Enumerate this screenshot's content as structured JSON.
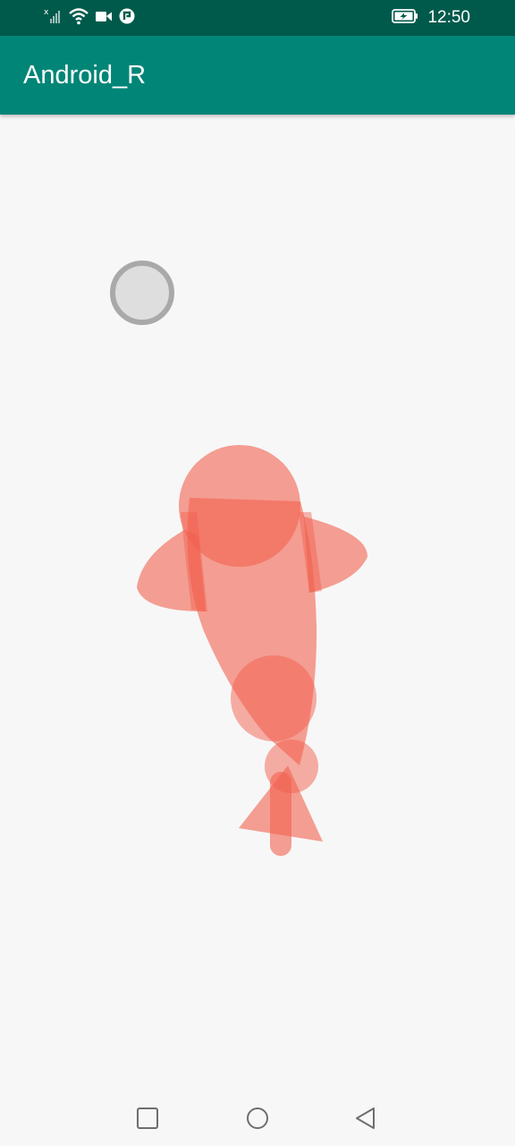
{
  "status_bar": {
    "time": "12:50",
    "icons": [
      "signal-icon",
      "wifi-icon",
      "video-camera-icon",
      "notification-icon",
      "battery-charging-icon"
    ]
  },
  "app_bar": {
    "title": "Android_R"
  },
  "canvas": {
    "fish_color": "#f2604e",
    "indicator_color": "#a9a9a9"
  },
  "nav_bar": {
    "buttons": [
      "recents-button",
      "home-button",
      "back-button"
    ]
  }
}
